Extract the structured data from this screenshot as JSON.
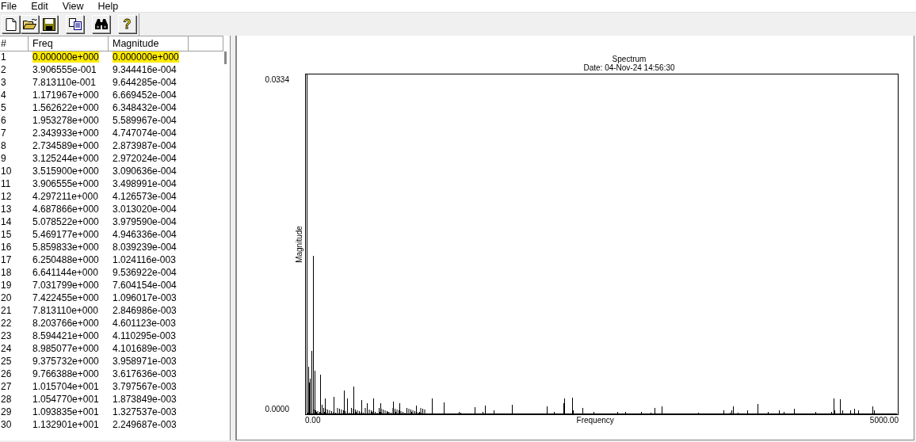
{
  "menu": [
    "File",
    "Edit",
    "View",
    "Help"
  ],
  "toolbar": [
    {
      "kind": "new"
    },
    {
      "kind": "open"
    },
    {
      "kind": "save"
    },
    {
      "kind": "gap"
    },
    {
      "kind": "copy"
    },
    {
      "kind": "gap"
    },
    {
      "kind": "find"
    },
    {
      "kind": "gap"
    },
    {
      "kind": "help",
      "label": "?"
    }
  ],
  "table": {
    "columns": [
      "#",
      "Freq",
      "Magnitude"
    ],
    "rows": [
      {
        "cells": [
          "1",
          "0.000000e+000",
          "0.000000e+000"
        ],
        "highlighted": true
      },
      {
        "cells": [
          "2",
          "3.906555e-001",
          "9.344416e-004"
        ],
        "highlighted": false
      },
      {
        "cells": [
          "3",
          "7.813110e-001",
          "9.644285e-004"
        ],
        "highlighted": false
      },
      {
        "cells": [
          "4",
          "1.171967e+000",
          "6.669452e-004"
        ],
        "highlighted": false
      },
      {
        "cells": [
          "5",
          "1.562622e+000",
          "6.348432e-004"
        ],
        "highlighted": false
      },
      {
        "cells": [
          "6",
          "1.953278e+000",
          "5.589967e-004"
        ],
        "highlighted": false
      },
      {
        "cells": [
          "7",
          "2.343933e+000",
          "4.747074e-004"
        ],
        "highlighted": false
      },
      {
        "cells": [
          "8",
          "2.734589e+000",
          "2.873987e-004"
        ],
        "highlighted": false
      },
      {
        "cells": [
          "9",
          "3.125244e+000",
          "2.972024e-004"
        ],
        "highlighted": false
      },
      {
        "cells": [
          "10",
          "3.515900e+000",
          "3.090636e-004"
        ],
        "highlighted": false
      },
      {
        "cells": [
          "11",
          "3.906555e+000",
          "3.498991e-004"
        ],
        "highlighted": false
      },
      {
        "cells": [
          "12",
          "4.297211e+000",
          "4.126573e-004"
        ],
        "highlighted": false
      },
      {
        "cells": [
          "13",
          "4.687866e+000",
          "3.013020e-004"
        ],
        "highlighted": false
      },
      {
        "cells": [
          "14",
          "5.078522e+000",
          "3.979590e-004"
        ],
        "highlighted": false
      },
      {
        "cells": [
          "15",
          "5.469177e+000",
          "4.946336e-004"
        ],
        "highlighted": false
      },
      {
        "cells": [
          "16",
          "5.859833e+000",
          "8.039239e-004"
        ],
        "highlighted": false
      },
      {
        "cells": [
          "17",
          "6.250488e+000",
          "1.024116e-003"
        ],
        "highlighted": false
      },
      {
        "cells": [
          "18",
          "6.641144e+000",
          "9.536922e-004"
        ],
        "highlighted": false
      },
      {
        "cells": [
          "19",
          "7.031799e+000",
          "7.604154e-004"
        ],
        "highlighted": false
      },
      {
        "cells": [
          "20",
          "7.422455e+000",
          "1.096017e-003"
        ],
        "highlighted": false
      },
      {
        "cells": [
          "21",
          "7.813110e+000",
          "2.846986e-003"
        ],
        "highlighted": false
      },
      {
        "cells": [
          "22",
          "8.203766e+000",
          "4.601123e-003"
        ],
        "highlighted": false
      },
      {
        "cells": [
          "23",
          "8.594421e+000",
          "4.110295e-003"
        ],
        "highlighted": false
      },
      {
        "cells": [
          "24",
          "8.985077e+000",
          "4.101689e-003"
        ],
        "highlighted": false
      },
      {
        "cells": [
          "25",
          "9.375732e+000",
          "3.958971e-003"
        ],
        "highlighted": false
      },
      {
        "cells": [
          "26",
          "9.766388e+000",
          "3.617636e-003"
        ],
        "highlighted": false
      },
      {
        "cells": [
          "27",
          "1.015704e+001",
          "3.797567e-003"
        ],
        "highlighted": false
      },
      {
        "cells": [
          "28",
          "1.054770e+001",
          "1.873849e-003"
        ],
        "highlighted": false
      },
      {
        "cells": [
          "29",
          "1.093835e+001",
          "1.327537e-003"
        ],
        "highlighted": false
      },
      {
        "cells": [
          "30",
          "1.132901e+001",
          "2.249687e-003"
        ],
        "highlighted": false
      }
    ]
  },
  "chart": {
    "title": "Spectrum",
    "subtitle": "Date: 04-Nov-24 14:56:30",
    "ylabel": "Magnitude",
    "xlabel": "Frequency",
    "y_max": "0.0334",
    "y_min": "0.0000",
    "x_min": "0.00",
    "x_max": "5000.00"
  }
}
